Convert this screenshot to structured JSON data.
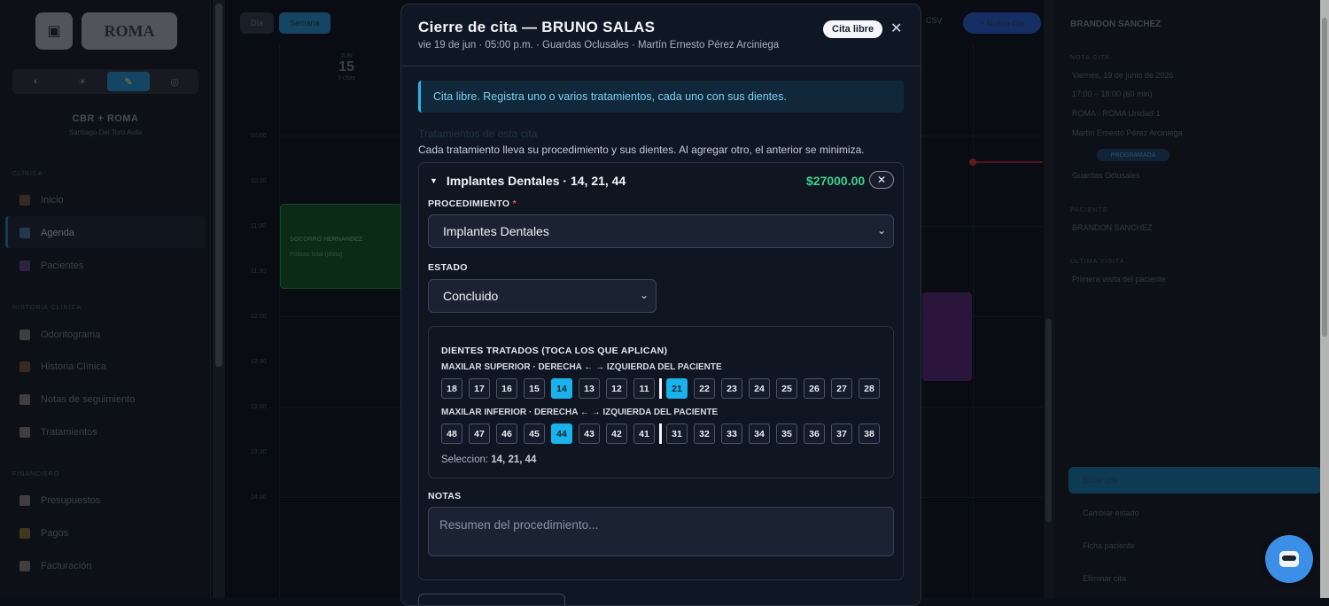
{
  "sidebar": {
    "logo_text": "ROMA",
    "clinic_name": "CBR + ROMA",
    "clinic_sub": "Santiago Del Toro Avila",
    "sections": [
      {
        "title": "CLÍNICA",
        "items": [
          "Inicio",
          "Agenda",
          "Pacientes"
        ]
      },
      {
        "title": "HISTORIA CLÍNICA",
        "items": [
          "Odontograma",
          "Historia Clínica",
          "Notas de seguimiento",
          "Tratamientos"
        ]
      },
      {
        "title": "FINANCIERO",
        "items": [
          "Presupuestos",
          "Pagos",
          "Facturación"
        ]
      }
    ]
  },
  "calendar": {
    "view_day": "Día",
    "view_week": "Semana",
    "day_label": "JUN",
    "day_number": "15",
    "day_count": "3 citas",
    "hours": [
      "10:00",
      "10:30",
      "11:00",
      "11:30",
      "12:00",
      "12:30",
      "13:00",
      "13:30",
      "14:00"
    ],
    "event_green_title": "SOCORRO HERNANDEZ",
    "event_green_line": "Pólizas total (plata)",
    "csv": "CSV",
    "new_appt": "+ Nueva cita"
  },
  "right_panel": {
    "patient": "BRANDON SANCHEZ",
    "section_cita": "NOTA CITA",
    "date": "Viernes, 19 de junio de 2026",
    "time": "17:00 – 18:00 (60 min)",
    "location": "ROMA · ROMA Unidad 1",
    "doctor": "Martín Ernesto Pérez Arciniega",
    "status": "PROGRAMADA",
    "service": "Guardas Oclusales",
    "section_patient": "PACIENTE",
    "patient_name": "BRANDON SANCHEZ",
    "section_last": "ÚLTIMA VISITA",
    "last_visit": "Primera visita del paciente",
    "actions": [
      "Editar cita",
      "Cambiar estado",
      "Ficha paciente",
      "Eliminar cita"
    ]
  },
  "modal": {
    "title": "Cierre de cita — BRUNO SALAS",
    "subtitle": "vie 19 de jun · 05:00 p.m. · Guardas Oclusales · Martín Ernesto Pérez Arciniega",
    "badge": "Cita libre",
    "close": "✕",
    "info": "Cita libre. Registra uno o varios tratamientos, cada uno con sus dientes.",
    "section_title": "Tratamientos de esta cita",
    "description": "Cada tratamiento lleva su procedimiento y sus dientes. Al agregar otro, el anterior se minimiza.",
    "treatment": {
      "header": "Implantes Dentales · 14, 21, 44",
      "price": "$27000.00",
      "remove": "✕",
      "procedure_label": "PROCEDIMIENTO",
      "procedure_required": "*",
      "procedure_value": "Implantes Dentales",
      "status_label": "ESTADO",
      "status_value": "Concluido",
      "teeth_title": "DIENTES TRATADOS (TOCA LOS QUE APLICAN)",
      "upper_label": "MAXILAR SUPERIOR · DERECHA ← → IZQUIERDA DEL PACIENTE",
      "upper_right": [
        "18",
        "17",
        "16",
        "15",
        "14",
        "13",
        "12",
        "11"
      ],
      "upper_left": [
        "21",
        "22",
        "23",
        "24",
        "25",
        "26",
        "27",
        "28"
      ],
      "lower_label": "MAXILAR INFERIOR · DERECHA ← → IZQUIERDA DEL PACIENTE",
      "lower_right": [
        "48",
        "47",
        "46",
        "45",
        "44",
        "43",
        "42",
        "41"
      ],
      "lower_left": [
        "31",
        "32",
        "33",
        "34",
        "35",
        "36",
        "37",
        "38"
      ],
      "selected": [
        "14",
        "21",
        "44"
      ],
      "selection_prefix": "Seleccion:",
      "selection_value": "14, 21, 44",
      "notes_label": "NOTAS",
      "notes_placeholder": "Resumen del procedimiento..."
    }
  },
  "colors": {
    "accent": "#19b2ea",
    "price": "#3fd08e",
    "required": "#ef4f5a"
  }
}
